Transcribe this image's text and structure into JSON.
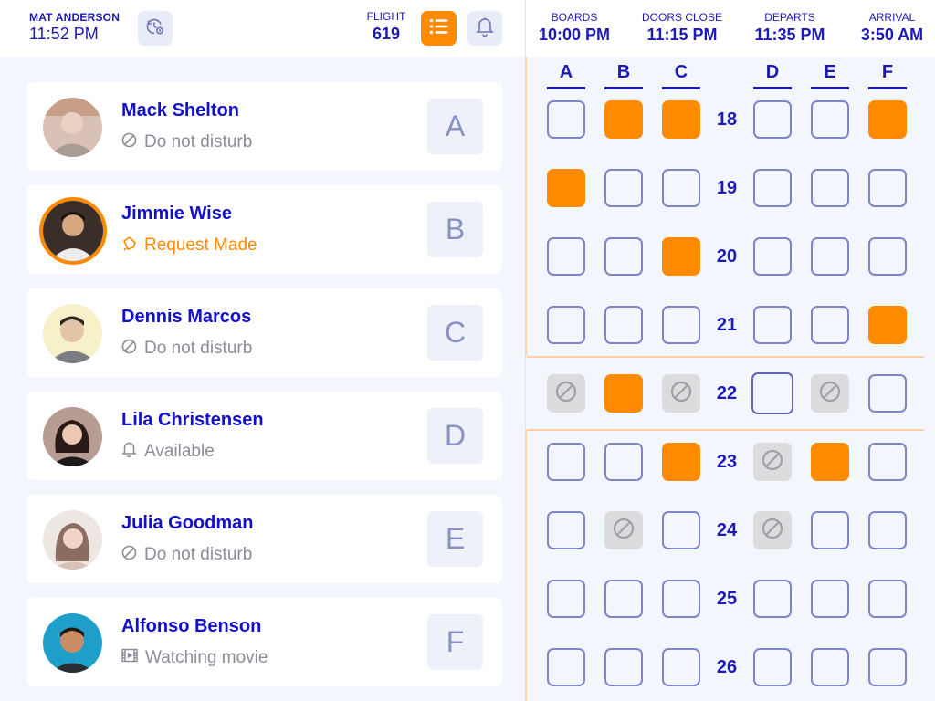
{
  "header": {
    "user_name": "MAT ANDERSON",
    "user_time": "11:52 PM",
    "flight_label": "FLIGHT",
    "flight_number": "619",
    "icons": [
      "history-icon",
      "list-icon",
      "bell-icon"
    ],
    "accent_color": "#FF8A00",
    "brand_color": "#1C1AB7"
  },
  "flight_info": [
    {
      "label": "BOARDS",
      "value": "10:00 PM"
    },
    {
      "label": "DOORS CLOSE",
      "value": "11:15 PM"
    },
    {
      "label": "DEPARTS",
      "value": "11:35 PM"
    },
    {
      "label": "ARRIVAL",
      "value": "3:50 AM"
    }
  ],
  "passengers": [
    {
      "name": "Mack Shelton",
      "status": "Do not disturb",
      "status_icon": "do-not-disturb-icon",
      "seat": "A"
    },
    {
      "name": "Jimmie Wise",
      "status": "Request Made",
      "status_icon": "request-bell-icon",
      "seat": "B",
      "active": true
    },
    {
      "name": "Dennis Marcos",
      "status": "Do not disturb",
      "status_icon": "do-not-disturb-icon",
      "seat": "C"
    },
    {
      "name": "Lila Christensen",
      "status": "Available",
      "status_icon": "bell-icon",
      "seat": "D"
    },
    {
      "name": "Julia Goodman",
      "status": "Do not disturb",
      "status_icon": "do-not-disturb-icon",
      "seat": "E"
    },
    {
      "name": "Alfonso Benson",
      "status": "Watching movie",
      "status_icon": "film-icon",
      "seat": "F"
    }
  ],
  "seat_map": {
    "columns": [
      "A",
      "B",
      "C",
      "D",
      "E",
      "F"
    ],
    "rows": [
      {
        "row": "18",
        "seats": [
          "empty",
          "taken",
          "taken",
          "empty",
          "empty",
          "taken"
        ]
      },
      {
        "row": "19",
        "seats": [
          "taken",
          "empty",
          "empty",
          "empty",
          "empty",
          "empty"
        ]
      },
      {
        "row": "20",
        "seats": [
          "empty",
          "empty",
          "taken",
          "empty",
          "empty",
          "empty"
        ]
      },
      {
        "row": "21",
        "seats": [
          "empty",
          "empty",
          "empty",
          "empty",
          "empty",
          "taken"
        ]
      },
      {
        "row": "22",
        "seats": [
          "blocked",
          "taken",
          "blocked",
          "selected",
          "blocked",
          "empty"
        ]
      },
      {
        "row": "23",
        "seats": [
          "empty",
          "empty",
          "taken",
          "blocked",
          "taken",
          "empty"
        ]
      },
      {
        "row": "24",
        "seats": [
          "empty",
          "blocked",
          "empty",
          "blocked",
          "empty",
          "empty"
        ]
      },
      {
        "row": "25",
        "seats": [
          "empty",
          "empty",
          "empty",
          "empty",
          "empty",
          "empty"
        ]
      },
      {
        "row": "26",
        "seats": [
          "empty",
          "empty",
          "empty",
          "empty",
          "empty",
          "empty"
        ]
      }
    ]
  }
}
